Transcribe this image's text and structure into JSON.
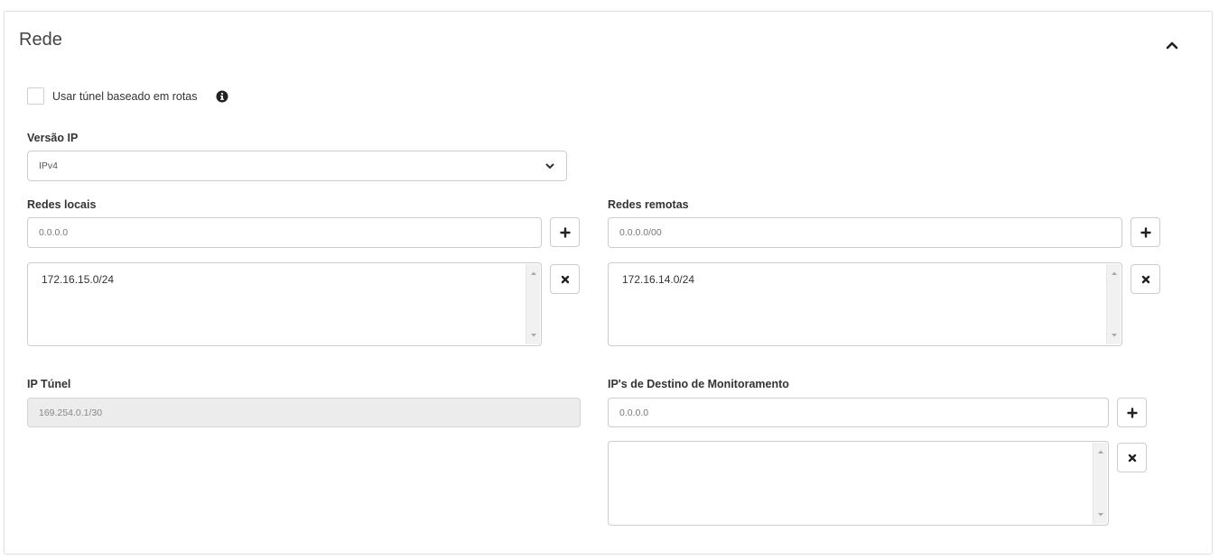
{
  "section": {
    "title": "Rede",
    "collapse_icon": "chevron-up-icon"
  },
  "route_tunnel": {
    "label": "Usar túnel baseado em rotas",
    "checked": false,
    "info_icon": "info-circle-icon"
  },
  "ip_version": {
    "label": "Versão IP",
    "selected": "IPv4"
  },
  "local_networks": {
    "label": "Redes locais",
    "placeholder": "0.0.0.0",
    "items": [
      "172.16.15.0/24"
    ]
  },
  "remote_networks": {
    "label": "Redes remotas",
    "placeholder": "0.0.0.0/00",
    "items": [
      "172.16.14.0/24"
    ]
  },
  "tunnel_ip": {
    "label": "IP Túnel",
    "value": "169.254.0.1/30"
  },
  "monitor_ips": {
    "label": "IP's de Destino de Monitoramento",
    "placeholder": "0.0.0.0",
    "items": []
  },
  "buttons": {
    "add_icon": "plus-icon",
    "remove_icon": "times-icon"
  }
}
